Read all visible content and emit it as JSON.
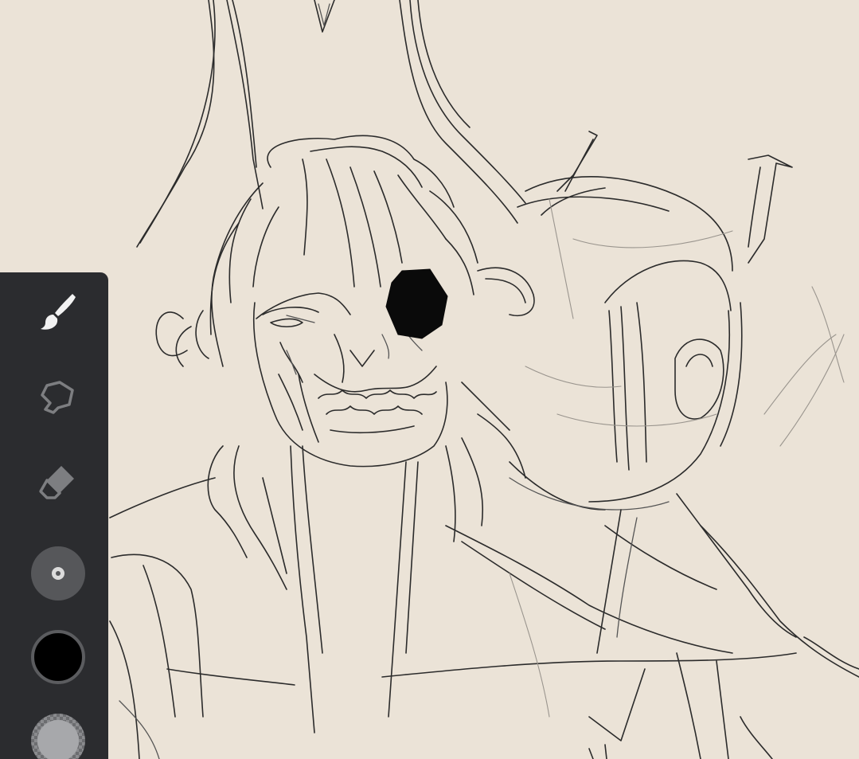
{
  "app": {
    "canvas_color": "#ebe3d7",
    "line_color": "#2b2b2b",
    "toolbar_color": "#2b2c2f"
  },
  "toolbar": {
    "tools": [
      {
        "name": "brush",
        "icon": "paintbrush-icon",
        "active": true
      },
      {
        "name": "lasso",
        "icon": "lasso-icon",
        "active": false
      },
      {
        "name": "eraser",
        "icon": "eraser-icon",
        "active": false
      }
    ],
    "brush_size_icon": "brush-size-icon",
    "current_color": "#000000",
    "opacity_color": "#a7a8ab",
    "active_tool_color": "#f2f2f2",
    "inactive_tool_color": "#7d7e81"
  }
}
